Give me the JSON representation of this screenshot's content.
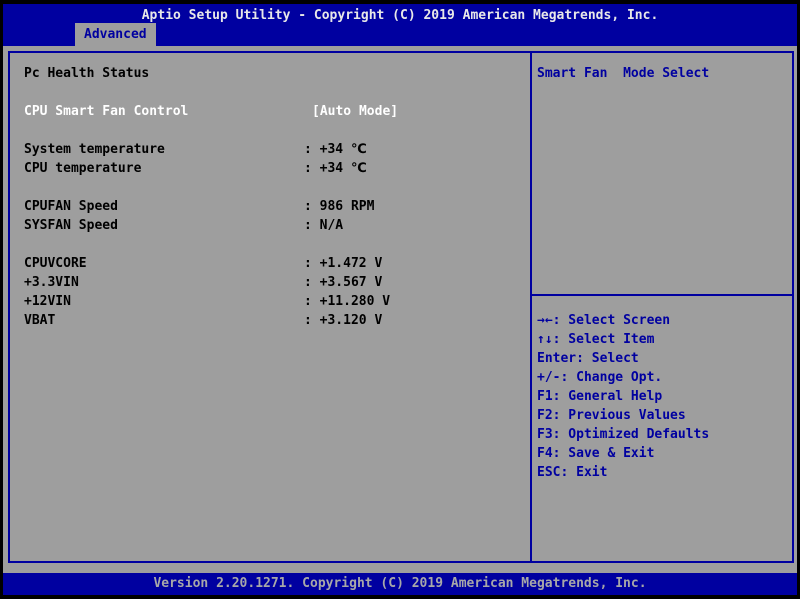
{
  "colors": {
    "header_blue": "#0000A0",
    "screen_gray": "#9E9E9E",
    "border_blue": "#0000A0",
    "selected_text_white": "#FFFFFF",
    "item_text_black": "#000000",
    "help_text_blue": "#0000A0",
    "footer_text_gray": "#A8A8A8",
    "outer_border_black": "#000000"
  },
  "header": {
    "title": "Aptio Setup Utility - Copyright (C) 2019 American Megatrends, Inc.",
    "tabs": [
      {
        "label": "Advanced",
        "active": true
      }
    ]
  },
  "left_panel": {
    "rows": [
      {
        "label": "Pc Health Status",
        "value": "",
        "type": "section"
      },
      {
        "blank": true
      },
      {
        "label": "CPU Smart Fan Control",
        "value": "[Auto Mode]",
        "selected": true
      },
      {
        "blank": true
      },
      {
        "label": "System temperature",
        "value": ": +34 ℃"
      },
      {
        "label": "CPU temperature",
        "value": ": +34 ℃"
      },
      {
        "blank": true
      },
      {
        "label": "CPUFAN Speed",
        "value": ": 986 RPM"
      },
      {
        "label": "SYSFAN Speed",
        "value": ": N/A"
      },
      {
        "blank": true
      },
      {
        "label": "CPUVCORE",
        "value": ": +1.472 V"
      },
      {
        "label": "+3.3VIN",
        "value": ": +3.567 V"
      },
      {
        "label": "+12VIN",
        "value": ": +11.280 V"
      },
      {
        "label": "VBAT",
        "value": ": +3.120 V"
      }
    ]
  },
  "right_panel": {
    "help_text": "Smart Fan  Mode Select",
    "keys": [
      "→←: Select Screen",
      "↑↓: Select Item",
      "Enter: Select",
      "+/-: Change Opt.",
      "F1: General Help",
      "F2: Previous Values",
      "F3: Optimized Defaults",
      "F4: Save & Exit",
      "ESC: Exit"
    ]
  },
  "footer": {
    "text": "Version 2.20.1271. Copyright (C) 2019 American Megatrends, Inc."
  }
}
